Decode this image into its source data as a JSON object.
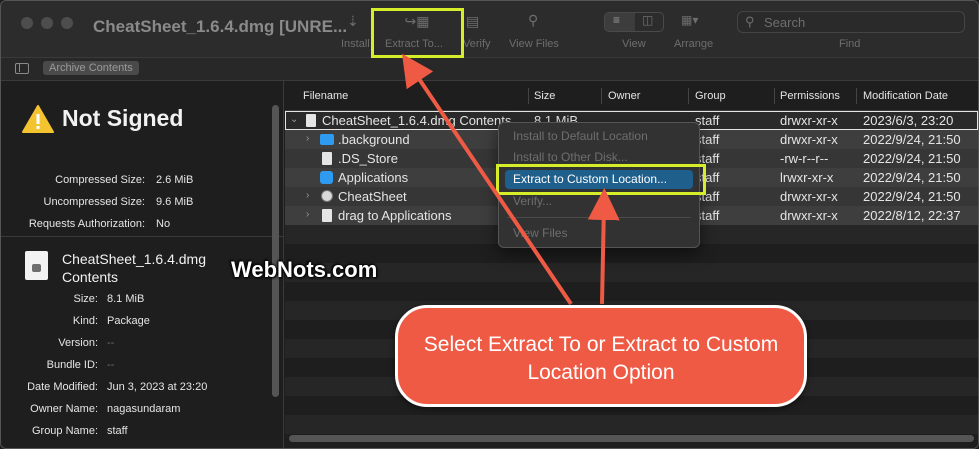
{
  "window": {
    "title": "CheatSheet_1.6.4.dmg [UNRE..."
  },
  "toolbar": {
    "install_label": "Install",
    "extract_label": "Extract To...",
    "verify_label": "Verify",
    "view_files_label": "View Files",
    "view_label": "View",
    "arrange_label": "Arrange",
    "find_label": "Find",
    "search_placeholder": "Search"
  },
  "pathbar": {
    "chip": "Archive Contents"
  },
  "inspector": {
    "title": "Not Signed",
    "archive": [
      {
        "key": "Compressed Size:",
        "value": "2.6 MiB"
      },
      {
        "key": "Uncompressed Size:",
        "value": "9.6 MiB"
      },
      {
        "key": "Requests Authorization:",
        "value": "No"
      }
    ],
    "file_name_line1": "CheatSheet_1.6.4.dmg",
    "file_name_line2": "Contents",
    "file": [
      {
        "key": "Size:",
        "value": "8.1 MiB"
      },
      {
        "key": "Kind:",
        "value": "Package"
      },
      {
        "key": "Version:",
        "value": "--"
      },
      {
        "key": "Bundle ID:",
        "value": "--"
      },
      {
        "key": "Date Modified:",
        "value": "Jun 3, 2023 at 23:20"
      },
      {
        "key": "Owner Name:",
        "value": "nagasundaram"
      },
      {
        "key": "Group Name:",
        "value": "staff"
      }
    ]
  },
  "list": {
    "columns": [
      "Filename",
      "Size",
      "Owner",
      "Group",
      "Permissions",
      "Modification Date"
    ],
    "rows": [
      {
        "name": "CheatSheet_1.6.4.dmg Contents",
        "size": "8.1 MiB",
        "owner": "",
        "group": "staff",
        "permissions": "drwxr-xr-x",
        "date": "2023/6/3, 23:20"
      },
      {
        "name": ".background",
        "size": "",
        "owner": "",
        "group": "staff",
        "permissions": "drwxr-xr-x",
        "date": "2022/9/24, 21:50"
      },
      {
        "name": ".DS_Store",
        "size": "",
        "owner": "",
        "group": "staff",
        "permissions": "-rw-r--r--",
        "date": "2022/9/24, 21:50"
      },
      {
        "name": "Applications",
        "size": "",
        "owner": "",
        "group": "staff",
        "permissions": "lrwxr-xr-x",
        "date": "2022/9/24, 21:50"
      },
      {
        "name": "CheatSheet",
        "size": "",
        "owner": "",
        "group": "staff",
        "permissions": "drwxr-xr-x",
        "date": "2022/9/24, 21:50"
      },
      {
        "name": "drag to Applications",
        "size": "",
        "owner": "",
        "group": "staff",
        "permissions": "drwxr-xr-x",
        "date": "2022/8/12, 22:37"
      }
    ]
  },
  "context_menu": {
    "items": [
      "Install to Default Location",
      "Install to Other Disk...",
      "Extract to Custom Location...",
      "Verify...",
      "View Files"
    ]
  },
  "annotation": {
    "callout": "Select Extract To or Extract to Custom Location Option",
    "highlight_color": "#d6ee2a",
    "callout_color": "#ef5a45",
    "arrow_color": "#ef5a45"
  },
  "watermark": "WebNots.com",
  "colors": {
    "accent": "#1f5f8c",
    "folder": "#2f9bf0",
    "warning": "#f4c430"
  }
}
